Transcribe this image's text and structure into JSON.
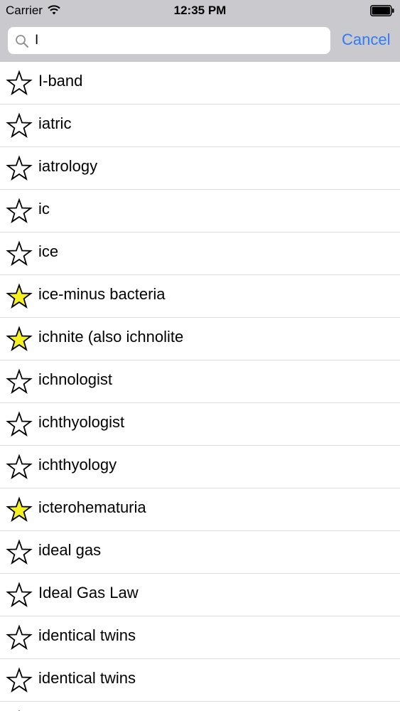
{
  "status_bar": {
    "carrier": "Carrier",
    "time": "12:35 PM",
    "wifi_icon": "wifi-icon",
    "battery_icon": "battery-icon"
  },
  "search": {
    "value": "I",
    "placeholder": "",
    "search_icon": "search-icon",
    "cancel_label": "Cancel",
    "accent_color": "#2f7cf6"
  },
  "results": [
    {
      "term": "I-band",
      "favorited": false
    },
    {
      "term": "iatric",
      "favorited": false
    },
    {
      "term": "iatrology",
      "favorited": false
    },
    {
      "term": "ic",
      "favorited": false
    },
    {
      "term": "ice",
      "favorited": false
    },
    {
      "term": "ice-minus bacteria",
      "favorited": true
    },
    {
      "term": "ichnite (also ichnolite",
      "favorited": true
    },
    {
      "term": "ichnologist",
      "favorited": false
    },
    {
      "term": "ichthyologist",
      "favorited": false
    },
    {
      "term": "ichthyology",
      "favorited": false
    },
    {
      "term": "icterohematuria",
      "favorited": true
    },
    {
      "term": "ideal gas",
      "favorited": false
    },
    {
      "term": "Ideal Gas Law",
      "favorited": false
    },
    {
      "term": "identical twins",
      "favorited": false
    },
    {
      "term": "identical twins",
      "favorited": false
    },
    {
      "term": "",
      "favorited": false
    }
  ],
  "colors": {
    "bar_background": "#c9c9ce",
    "star_favorited_fill": "#f5f020",
    "star_outline": "#000000",
    "divider": "#dcdcdc"
  }
}
